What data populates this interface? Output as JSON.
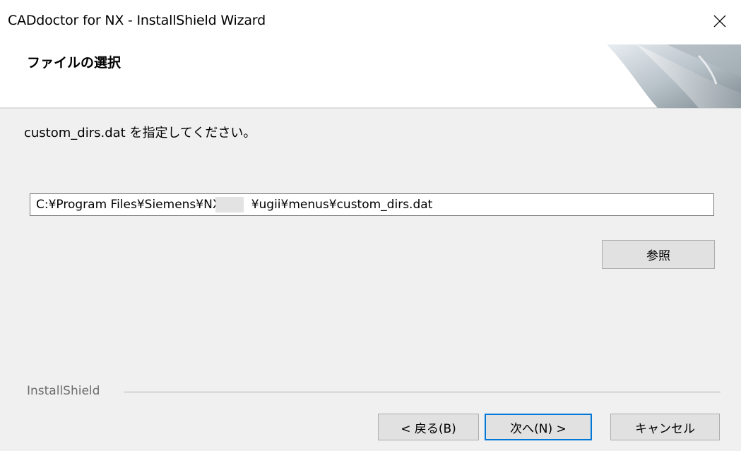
{
  "window": {
    "title": "CADdoctor for NX - InstallShield Wizard",
    "close_icon": "close-icon"
  },
  "header": {
    "title": "ファイルの選択",
    "graphic_icon": "installshield-swoosh-graphic"
  },
  "main": {
    "instruction": "custom_dirs.dat を指定してください。",
    "path_value": "C:¥Program Files¥Siemens¥NX        ¥ugii¥menus¥custom_dirs.dat",
    "browse_label": "参照"
  },
  "footer": {
    "brand": "InstallShield",
    "back_label": "< 戻る(B)",
    "next_label": "次へ(N) >",
    "cancel_label": "キャンセル"
  },
  "colors": {
    "title_bg": "#ffffff",
    "body_bg": "#f0f0f0",
    "button_bg": "#e1e1e1",
    "default_button_border": "#0078d7"
  }
}
